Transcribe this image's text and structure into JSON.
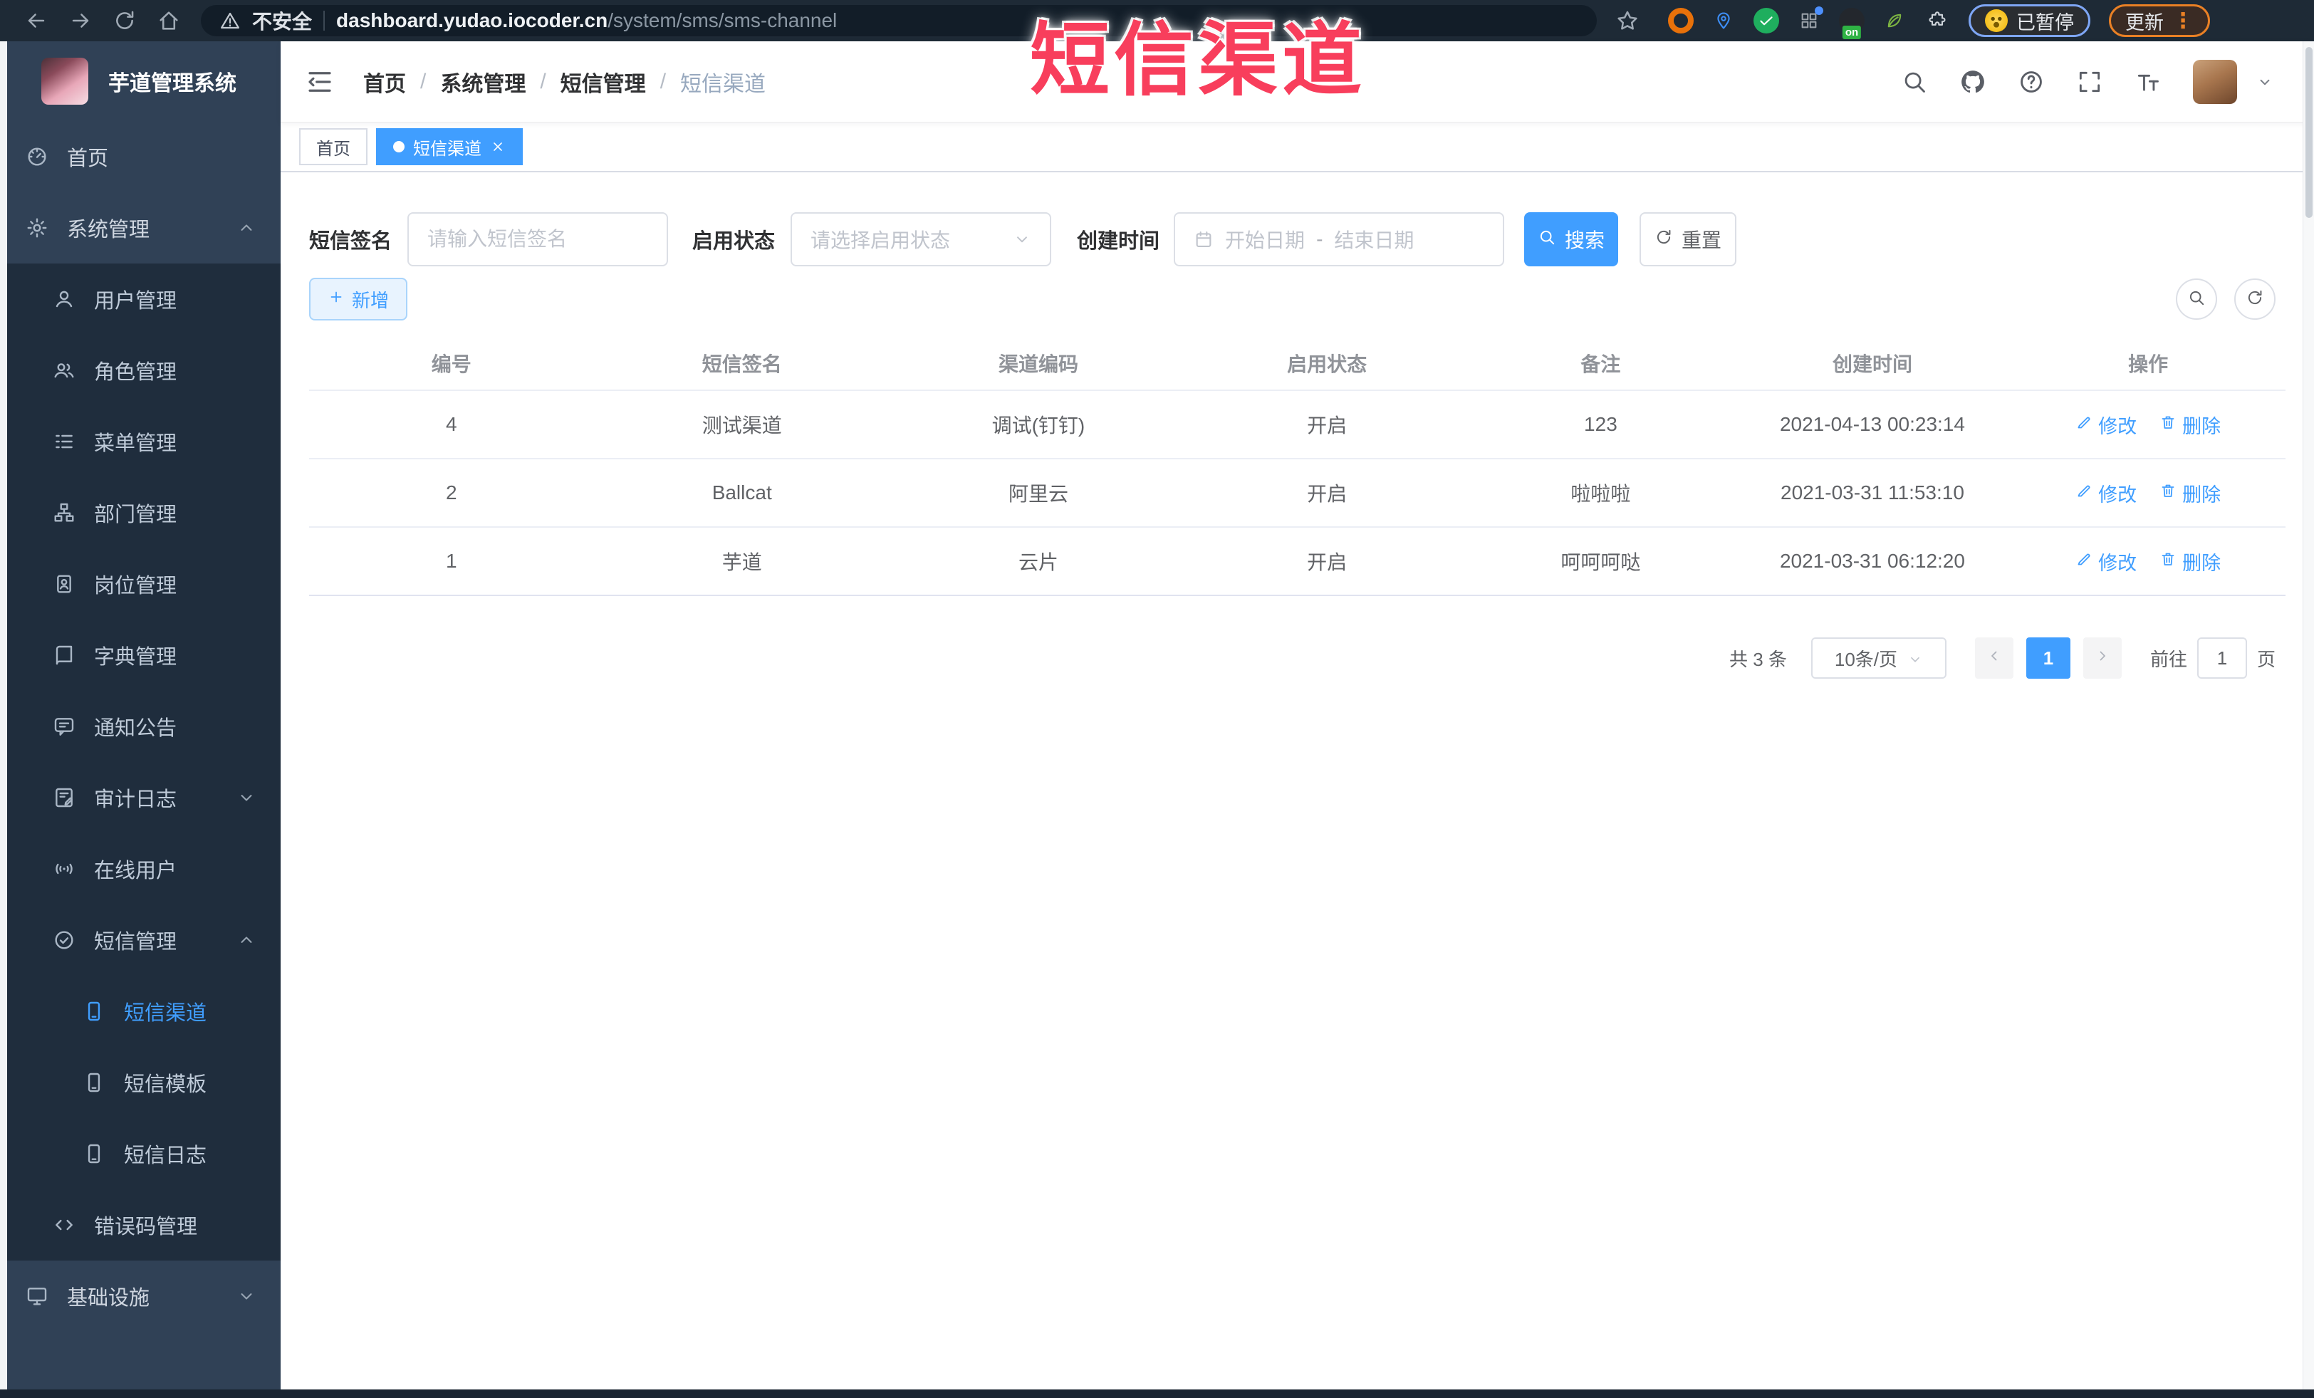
{
  "colors": {
    "accent": "#409eff",
    "sidebar_bg": "#304156",
    "submenu_bg": "#1f2d3d",
    "sidebar_text": "#bfcbd9",
    "browser_bar_bg": "#1e2a36",
    "watermark": "#f83e5c",
    "link": "#409eff"
  },
  "watermark": {
    "text": "短信渠道"
  },
  "browser": {
    "security_label": "不安全",
    "url_domain": "dashboard.yudao.iocoder.cn",
    "url_path": "/system/sms/sms-channel",
    "paused_label": "已暂停",
    "update_label": "更新",
    "menu_dots": "⋮",
    "extensions": [
      {
        "name": "orange-ring-extension",
        "color": "#e8710a",
        "shape": "ring"
      },
      {
        "name": "location-pin-extension",
        "color": "#3d8ef7",
        "shape": "glyph",
        "icon": "pin"
      },
      {
        "name": "green-check-extension",
        "color": "#1fae5e",
        "shape": "fill",
        "icon": "check"
      },
      {
        "name": "grid-extension",
        "color": "#9aa1a9",
        "shape": "glyph",
        "icon": "gridicon",
        "dot": "#4d90fe"
      },
      {
        "name": "recorder-extension",
        "color": "#23272d",
        "shape": "fill",
        "badge": "on",
        "badge_color": "#2fb344"
      },
      {
        "name": "leaf-extension",
        "color": "#7cb342",
        "shape": "glyph",
        "icon": "leaf"
      },
      {
        "name": "puzzle-extensions-icon",
        "color": "#cfd5db",
        "shape": "glyph",
        "icon": "puzzle"
      }
    ]
  },
  "sidebar": {
    "app_title": "芋道管理系统",
    "items": [
      {
        "key": "home",
        "label": "首页",
        "icon": "dashboard",
        "level": 1
      },
      {
        "key": "system",
        "label": "系统管理",
        "icon": "gear",
        "level": 1,
        "arrow": "up"
      },
      {
        "key": "user",
        "label": "用户管理",
        "icon": "user",
        "level": 2
      },
      {
        "key": "role",
        "label": "角色管理",
        "icon": "users",
        "level": 2
      },
      {
        "key": "menu",
        "label": "菜单管理",
        "icon": "menulist",
        "level": 2
      },
      {
        "key": "dept",
        "label": "部门管理",
        "icon": "orgtree",
        "level": 2
      },
      {
        "key": "post",
        "label": "岗位管理",
        "icon": "idbadge",
        "level": 2
      },
      {
        "key": "dict",
        "label": "字典管理",
        "icon": "book",
        "level": 2
      },
      {
        "key": "notice",
        "label": "通知公告",
        "icon": "notice",
        "level": 2
      },
      {
        "key": "audit-log",
        "label": "审计日志",
        "icon": "auditlog",
        "level": 2,
        "arrow": "down"
      },
      {
        "key": "online-user",
        "label": "在线用户",
        "icon": "online",
        "level": 2
      },
      {
        "key": "sms",
        "label": "短信管理",
        "icon": "smscircle",
        "level": 2,
        "arrow": "up"
      },
      {
        "key": "sms-channel",
        "label": "短信渠道",
        "icon": "phone",
        "level": 3,
        "active": true
      },
      {
        "key": "sms-template",
        "label": "短信模板",
        "icon": "phone",
        "level": 3
      },
      {
        "key": "sms-log",
        "label": "短信日志",
        "icon": "phone",
        "level": 3
      },
      {
        "key": "error-code",
        "label": "错误码管理",
        "icon": "code",
        "level": 2
      },
      {
        "key": "infra",
        "label": "基础设施",
        "icon": "monitor",
        "level": 1,
        "arrow": "down"
      }
    ]
  },
  "breadcrumb": {
    "items": [
      "首页",
      "系统管理",
      "短信管理",
      "短信渠道"
    ]
  },
  "tags": [
    {
      "label": "首页",
      "active": false
    },
    {
      "label": "短信渠道",
      "active": true,
      "closable": true
    }
  ],
  "filters": {
    "sign_label": "短信签名",
    "sign_placeholder": "请输入短信签名",
    "status_label": "启用状态",
    "status_placeholder": "请选择启用状态",
    "time_label": "创建时间",
    "start_placeholder": "开始日期",
    "range_separator": "-",
    "end_placeholder": "结束日期",
    "search_label": "搜索",
    "reset_label": "重置"
  },
  "toolbar": {
    "add_label": "新增"
  },
  "table": {
    "headers": [
      "编号",
      "短信签名",
      "渠道编码",
      "启用状态",
      "备注",
      "创建时间",
      "操作"
    ],
    "rows": [
      {
        "id": "4",
        "sign": "测试渠道",
        "code": "调试(钉钉)",
        "status": "开启",
        "remark": "123",
        "created": "2021-04-13 00:23:14"
      },
      {
        "id": "2",
        "sign": "Ballcat",
        "code": "阿里云",
        "status": "开启",
        "remark": "啦啦啦",
        "created": "2021-03-31 11:53:10"
      },
      {
        "id": "1",
        "sign": "芋道",
        "code": "云片",
        "status": "开启",
        "remark": "呵呵呵哒",
        "created": "2021-03-31 06:12:20"
      }
    ],
    "actions": {
      "edit_label": "修改",
      "delete_label": "删除"
    }
  },
  "pagination": {
    "total_label": "共 3 条",
    "page_size_label": "10条/页",
    "current_page": "1",
    "goto_label": "前往",
    "goto_value": "1",
    "page_unit_label": "页"
  }
}
